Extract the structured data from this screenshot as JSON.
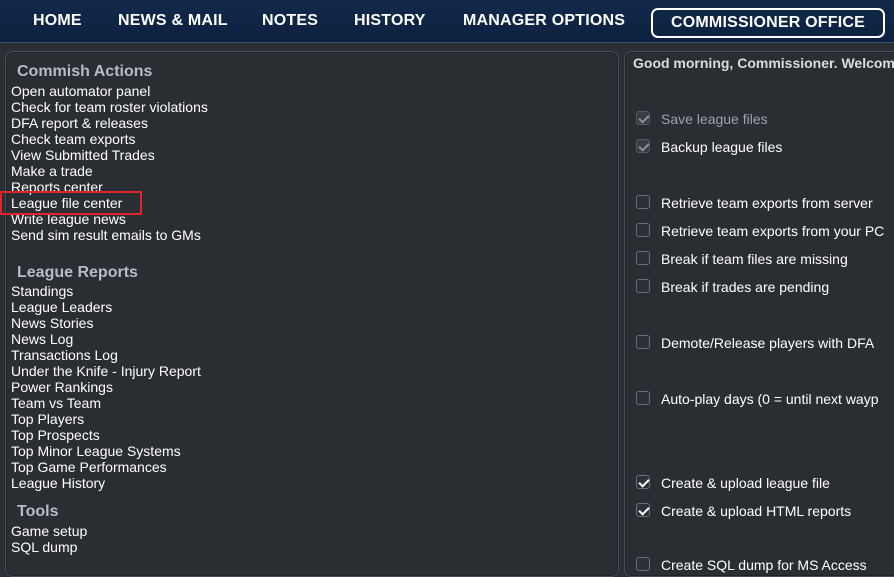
{
  "nav": {
    "items": [
      "HOME",
      "NEWS & MAIL",
      "NOTES",
      "HISTORY",
      "MANAGER OPTIONS"
    ],
    "active": "COMMISSIONER OFFICE"
  },
  "left": {
    "commish_title": "Commish Actions",
    "commish_actions": [
      "Open automator panel",
      "Check for team roster violations",
      "DFA report & releases",
      "Check team exports",
      "View Submitted Trades",
      "Make a trade",
      "Reports center",
      "League file center",
      "Write league news",
      "Send sim result emails to GMs"
    ],
    "reports_title": "League Reports",
    "reports": [
      "Standings",
      "League Leaders",
      "News Stories",
      "News Log",
      "Transactions Log",
      "Under the Knife - Injury Report",
      "Power Rankings",
      "Team vs Team",
      "Top Players",
      "Top Prospects",
      "Top Minor League Systems",
      "Top Game Performances",
      "League History"
    ],
    "tools_title": "Tools",
    "tools": [
      "Game setup",
      "SQL dump"
    ]
  },
  "right": {
    "greeting": "Good morning, Commissioner. Welcom",
    "options": [
      {
        "label": "Save league files",
        "checked": true,
        "disabled": true
      },
      {
        "label": "Backup league files",
        "checked": true,
        "disabled": true
      },
      {
        "label": "Retrieve team exports from server",
        "checked": false,
        "disabled": false
      },
      {
        "label": "Retrieve team exports from your PC",
        "checked": false,
        "disabled": false
      },
      {
        "label": "Break if team files are missing",
        "checked": false,
        "disabled": false
      },
      {
        "label": "Break if trades are pending",
        "checked": false,
        "disabled": false
      },
      {
        "label": "Demote/Release players with DFA",
        "checked": false,
        "disabled": false
      },
      {
        "label": "Auto-play days (0 = until next wayp",
        "checked": false,
        "disabled": false
      },
      {
        "label": "Create & upload league file",
        "checked": true,
        "disabled": false
      },
      {
        "label": "Create & upload HTML reports",
        "checked": true,
        "disabled": false
      },
      {
        "label": "Create SQL dump for MS Access",
        "checked": false,
        "disabled": false
      }
    ]
  }
}
